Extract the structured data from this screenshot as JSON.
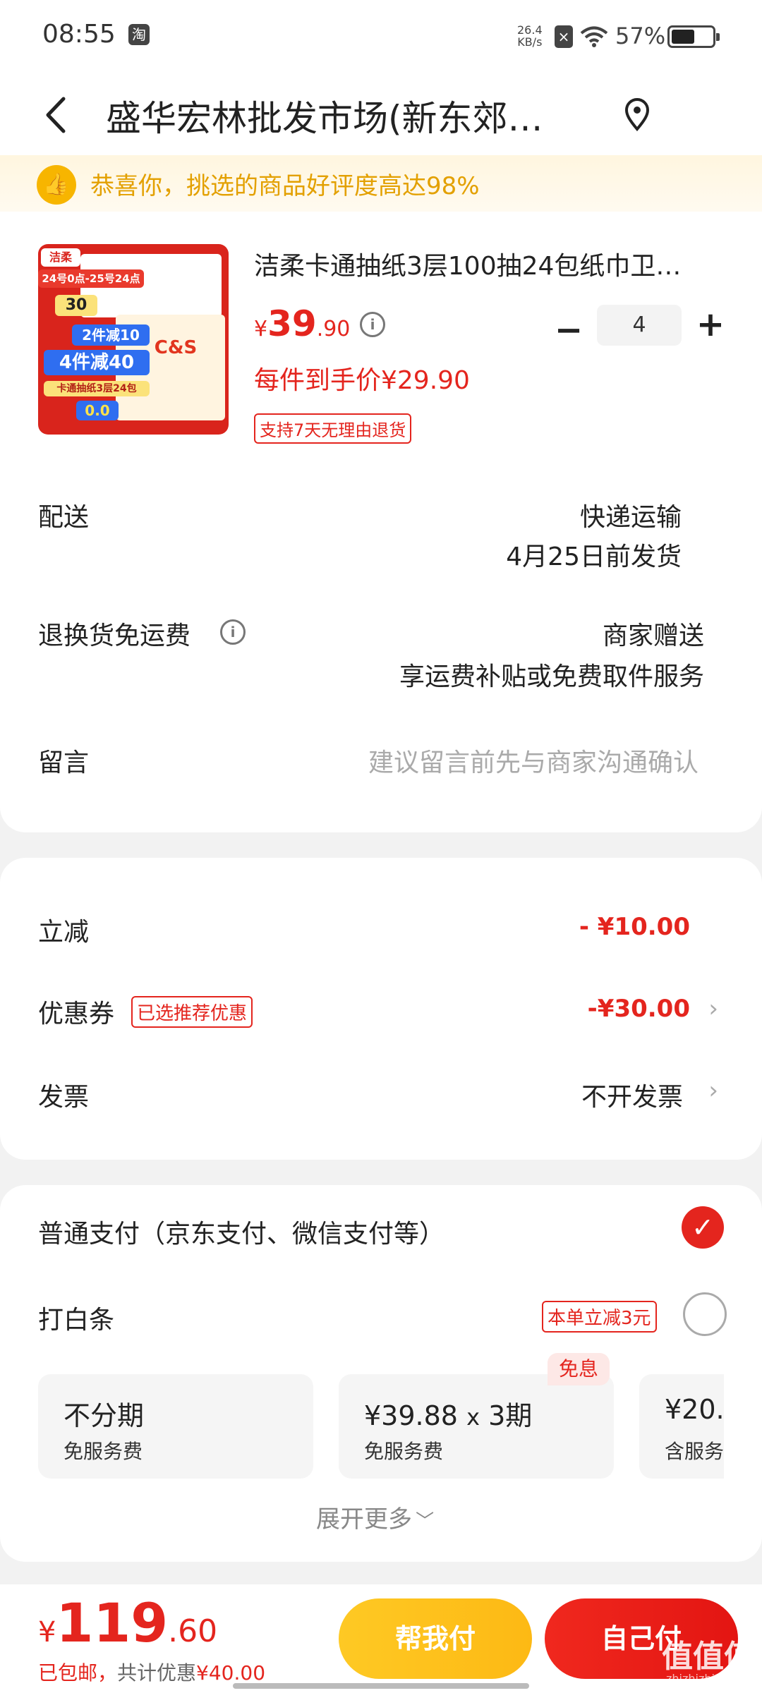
{
  "status": {
    "time": "08:55",
    "app_badge": "淘",
    "net_speed_value": "26.4",
    "net_speed_unit": "KB/s",
    "battery": "57%",
    "battery_level": 0.57
  },
  "header": {
    "title": "盛华宏林批发市场(新东郊…"
  },
  "banner": {
    "text": "恭喜你，挑选的商品好评度高达98%"
  },
  "product": {
    "title": "洁柔卡通抽纸3层100抽24包纸巾卫…",
    "price_symbol": "¥",
    "price_int": "39",
    "price_dec": ".90",
    "quantity": "4",
    "unit_price": "每件到手价¥29.90",
    "return_tag": "支持7天无理由退货",
    "image_texts": {
      "brand": "洁柔",
      "promo_top": "24号0点-25号24点",
      "coupon": "30",
      "deal1": "2件减10",
      "deal2": "4件减40",
      "product_line": "卡通抽纸3层24包",
      "cs": "C&S",
      "final_price": "0.0"
    }
  },
  "delivery": {
    "label": "配送",
    "method": "快递运输",
    "ship_date": "4月25日前发货"
  },
  "return_fee": {
    "label": "退换货免运费",
    "value": "商家赠送",
    "desc": "享运费补贴或免费取件服务"
  },
  "message": {
    "label": "留言",
    "placeholder": "建议留言前先与商家沟通确认"
  },
  "discounts": {
    "instant_label": "立减",
    "instant_value": "- ¥10.00",
    "coupon_label": "优惠券",
    "coupon_tag": "已选推荐优惠",
    "coupon_value": "-¥30.00",
    "invoice_label": "发票",
    "invoice_value": "不开发票"
  },
  "payment": {
    "normal_label": "普通支付（京东支付、微信支付等）",
    "baitiao_label": "打白条",
    "baitiao_tag": "本单立减3元",
    "free_badge": "免息",
    "plans": [
      {
        "main": "不分期",
        "sub": "免服务费"
      },
      {
        "main_price": "¥39.88",
        "main_x": "x",
        "main_period": "3期",
        "sub": "免服务费"
      },
      {
        "main": "¥20.",
        "sub": "含服务"
      }
    ],
    "expand": "展开更多"
  },
  "footer": {
    "total_symbol": "¥",
    "total_int": "119",
    "total_dec": ".60",
    "shipping": "已包邮，",
    "saving_prefix": "共计优惠",
    "saving_value": "¥40.00",
    "help_pay": "帮我付",
    "self_pay": "自己付",
    "watermark": "值值值",
    "watermark_site": "zhizhizhi.com"
  },
  "colors": {
    "accent_red": "#e4251e",
    "help_yellow": "#fdbd1a",
    "banner_gold": "#e3a000"
  }
}
